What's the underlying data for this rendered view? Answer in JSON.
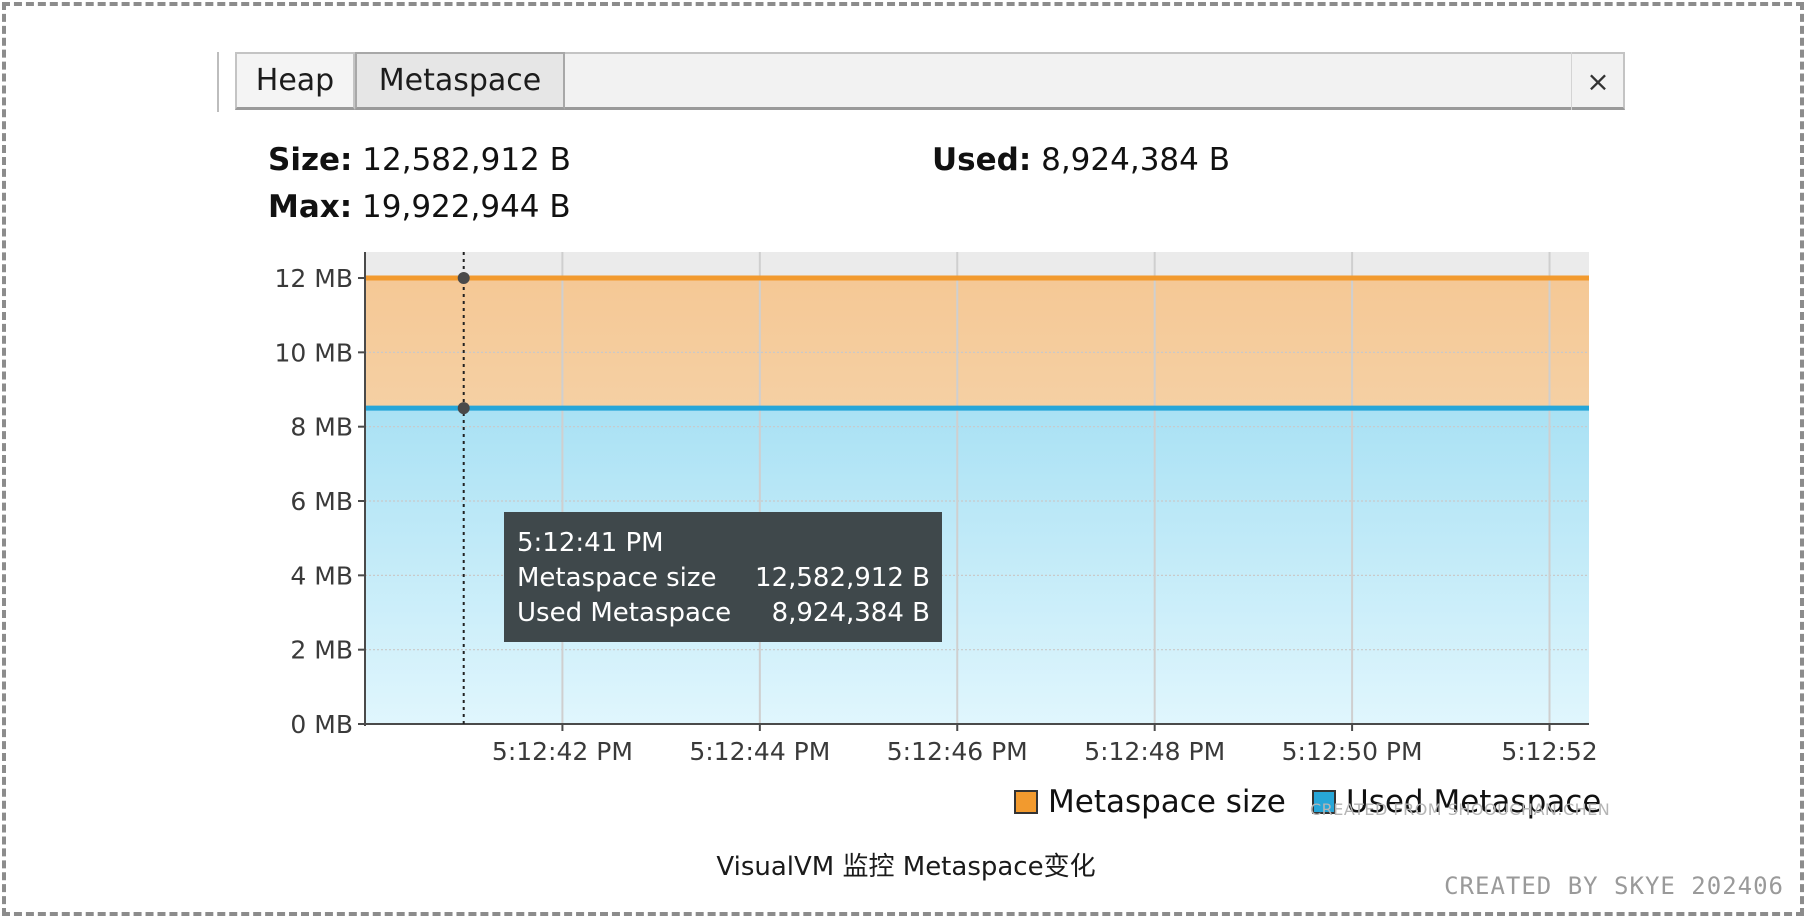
{
  "tabs": {
    "heap_label": "Heap",
    "metaspace_label": "Metaspace",
    "close_glyph": "×"
  },
  "stats": {
    "size_label": "Size:",
    "size_value": "12,582,912 B",
    "used_label": "Used:",
    "used_value": "8,924,384 B",
    "max_label": "Max:",
    "max_value": "19,922,944 B"
  },
  "chart_data": {
    "type": "area",
    "title": "",
    "xlabel": "",
    "ylabel": "",
    "ylim": [
      0,
      12.7
    ],
    "y_ticks": [
      0,
      2,
      4,
      6,
      8,
      10,
      12
    ],
    "y_tick_labels": [
      "0 MB",
      "2 MB",
      "4 MB",
      "6 MB",
      "8 MB",
      "10 MB",
      "12 MB"
    ],
    "x_ticks": [
      "5:12:42 PM",
      "5:12:44 PM",
      "5:12:46 PM",
      "5:12:48 PM",
      "5:12:50 PM",
      "5:12:52"
    ],
    "x_tick_seconds": [
      42,
      44,
      46,
      48,
      50,
      52
    ],
    "xlim_seconds": [
      40,
      52.4
    ],
    "cursor_second": 41,
    "grid": true,
    "legend_position": "bottom-right",
    "series": [
      {
        "name": "Metaspace size",
        "color": "#f29a2e",
        "fill_top": "#f5c895",
        "fill_bottom": "#f6e3c7",
        "value_mb": 12,
        "value_label": "12,582,912 B"
      },
      {
        "name": "Used Metaspace",
        "color": "#27a6d8",
        "fill_top": "#a9e1f4",
        "fill_bottom": "#e0f6fd",
        "value_mb": 8.5,
        "value_label": "8,924,384 B"
      }
    ],
    "tooltip": {
      "time": "5:12:41 PM"
    }
  },
  "watermark_small": "CREATED FROM SHOOUCHAN.CHEN",
  "caption": "VisualVM 监控 Metaspace变化",
  "credit": "CREATED BY SKYE 202406"
}
